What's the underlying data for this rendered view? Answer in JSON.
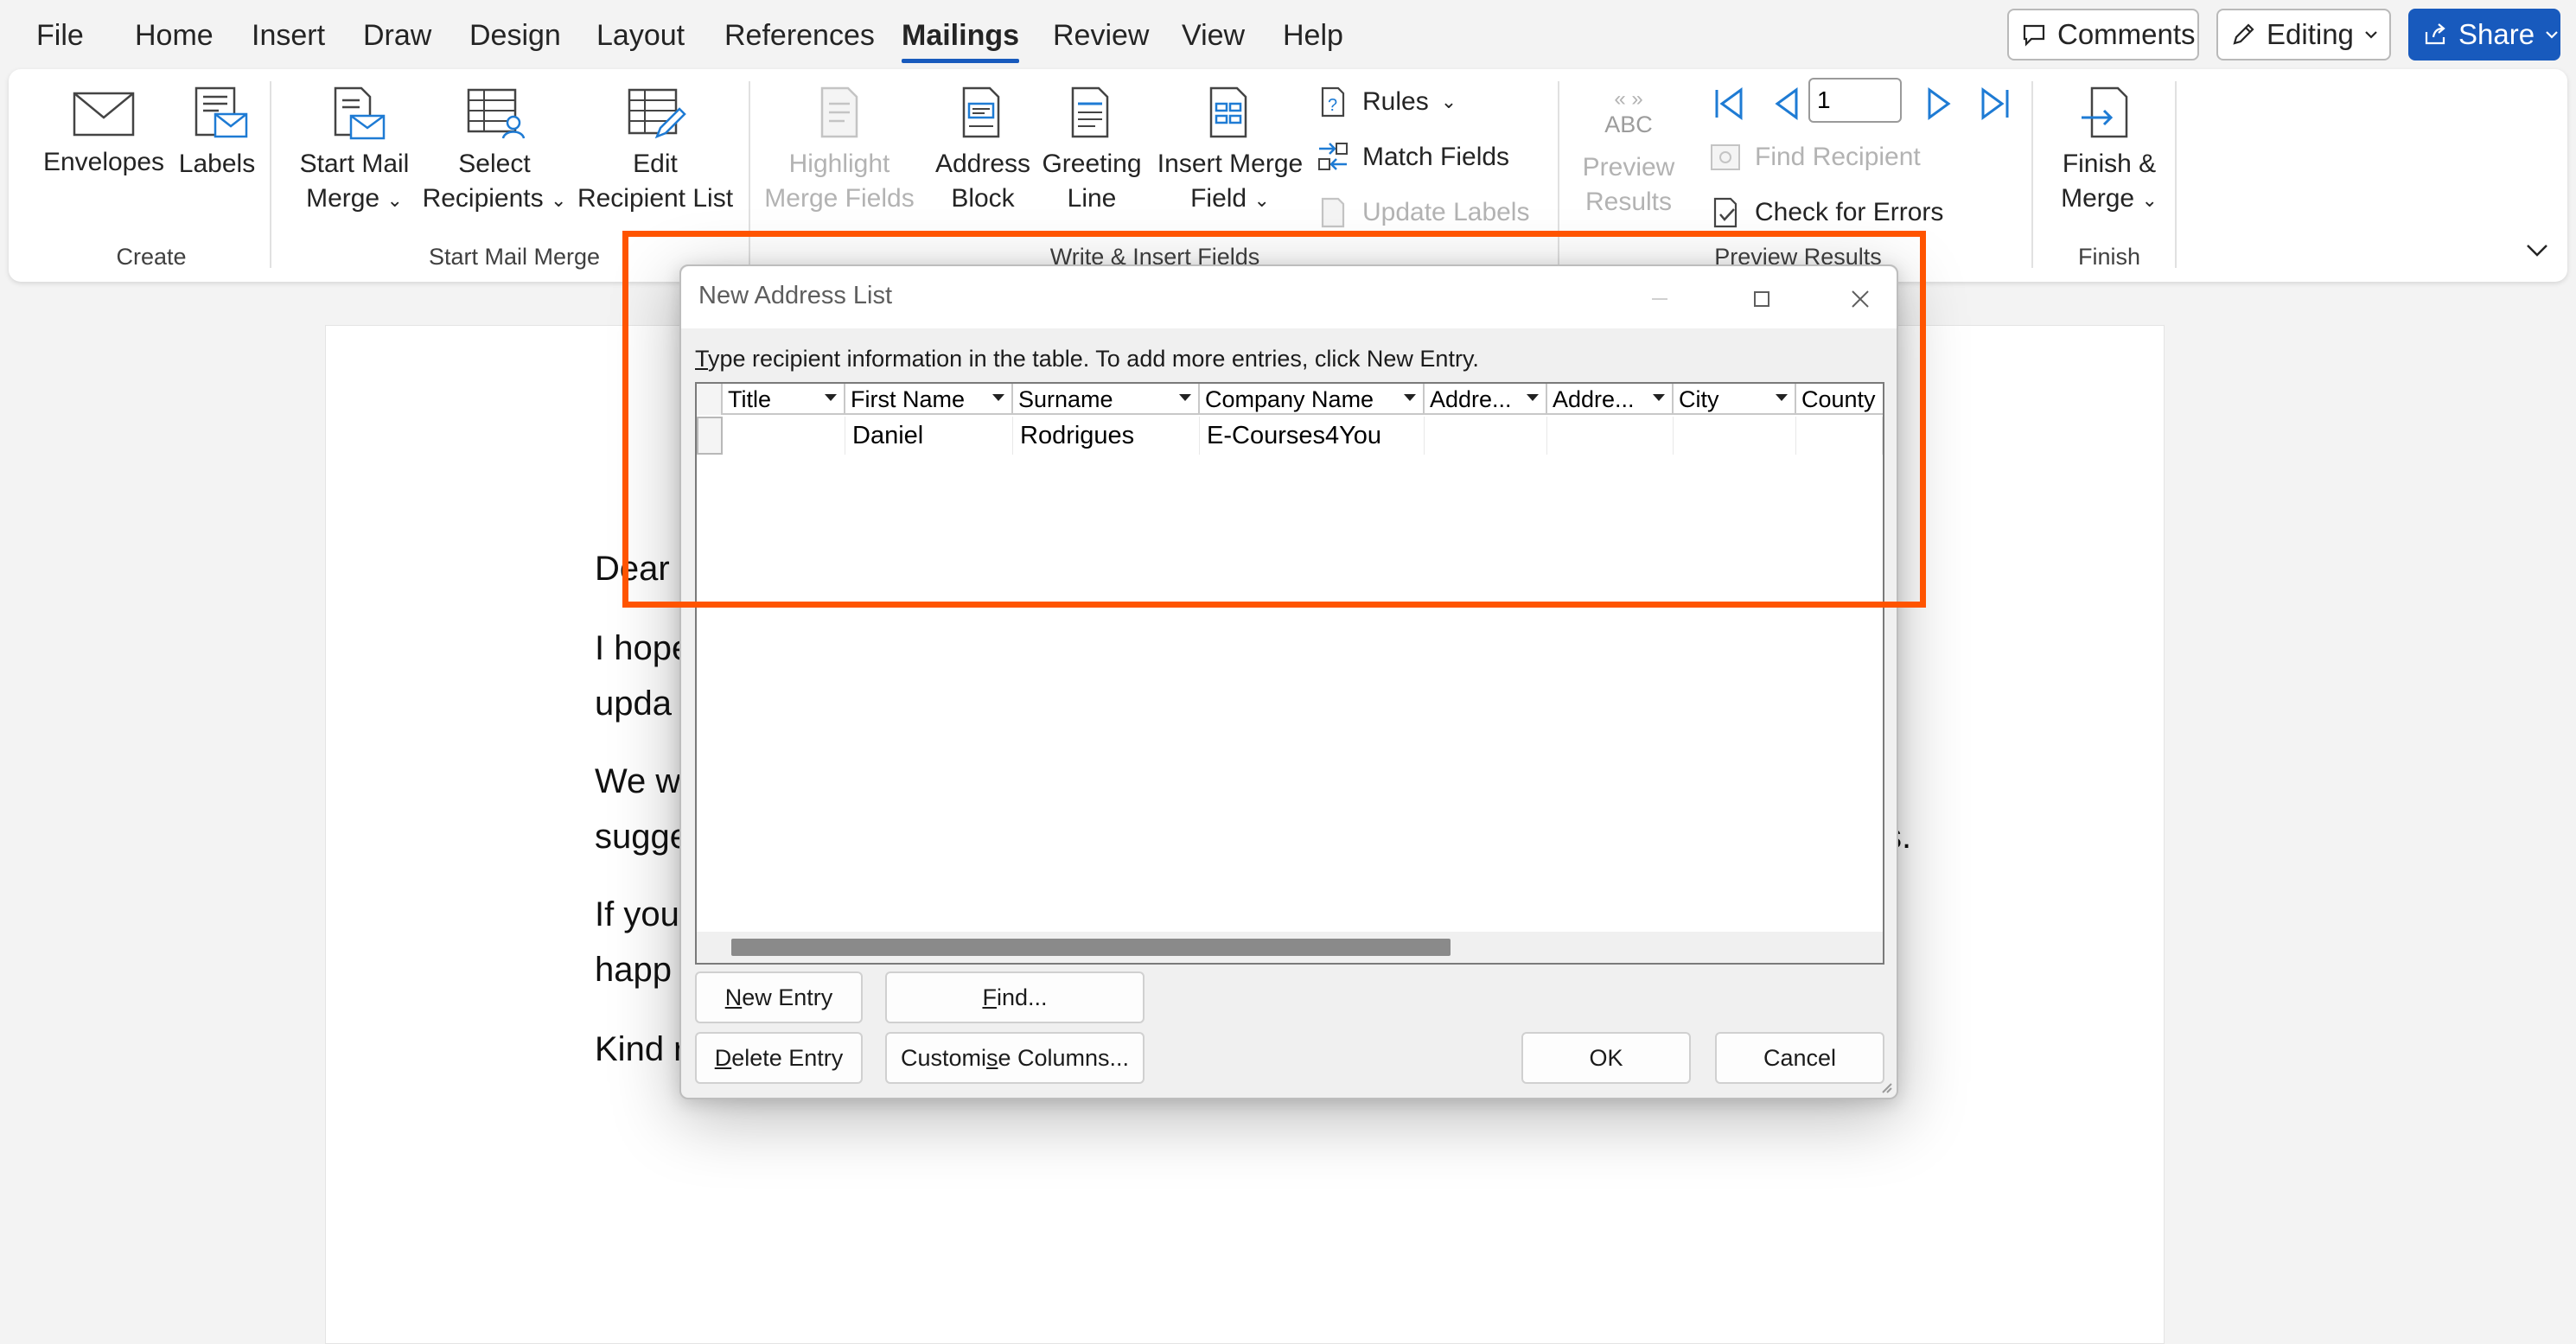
{
  "menu": {
    "tabs": [
      "File",
      "Home",
      "Insert",
      "Draw",
      "Design",
      "Layout",
      "References",
      "Mailings",
      "Review",
      "View",
      "Help"
    ],
    "active": "Mailings",
    "comments": "Comments",
    "editing": "Editing",
    "share": "Share"
  },
  "ribbon": {
    "envelopes": "Envelopes",
    "labels": "Labels",
    "create_group": "Create",
    "start_mail_merge_1": "Start Mail",
    "start_mail_merge_2": "Merge",
    "select_recipients_1": "Select",
    "select_recipients_2": "Recipients",
    "edit_recipient_1": "Edit",
    "edit_recipient_2": "Recipient List",
    "start_group": "Start Mail Merge",
    "highlight_1": "Highlight",
    "highlight_2": "Merge Fields",
    "address_block_1": "Address",
    "address_block_2": "Block",
    "greeting_1": "Greeting",
    "greeting_2": "Line",
    "insert_merge_1": "Insert Merge",
    "insert_merge_2": "Field",
    "rules": "Rules",
    "match_fields": "Match Fields",
    "update_labels": "Update Labels",
    "write_group": "Write & Insert Fields",
    "abc": "ABC",
    "preview_1": "Preview",
    "preview_2": "Results",
    "record_number": "1",
    "find_recipient": "Find Recipient",
    "check_errors": "Check for Errors",
    "preview_group": "Preview Results",
    "finish_1": "Finish &",
    "finish_2": "Merge",
    "finish_group": "Finish"
  },
  "document": {
    "lines": [
      "Dear",
      "I hope",
      "upda",
      "We w",
      "sugge",
      "s.",
      "If you",
      "happ",
      "Kind r"
    ]
  },
  "dialog": {
    "title": "New Address List",
    "instruction_pre": "",
    "instruction_u": "T",
    "instruction_rest": "ype recipient information in the table.  To add more entries, click New Entry.",
    "columns": [
      "Title",
      "First Name",
      "Surname",
      "Company Name",
      "Addre...",
      "Addre...",
      "City",
      "County"
    ],
    "row": [
      "",
      "Daniel",
      "Rodrigues",
      "E-Courses4You",
      "",
      "",
      "",
      ""
    ],
    "new_entry_u": "N",
    "new_entry_rest": "ew Entry",
    "find_u": "F",
    "find_rest": "ind...",
    "delete_u": "D",
    "delete_rest": "elete Entry",
    "customise_pre": "Customi",
    "customise_u": "s",
    "customise_rest": "e Columns...",
    "ok": "OK",
    "cancel": "Cancel"
  },
  "colors": {
    "accent": "#185abd",
    "highlight": "#ff5400"
  }
}
